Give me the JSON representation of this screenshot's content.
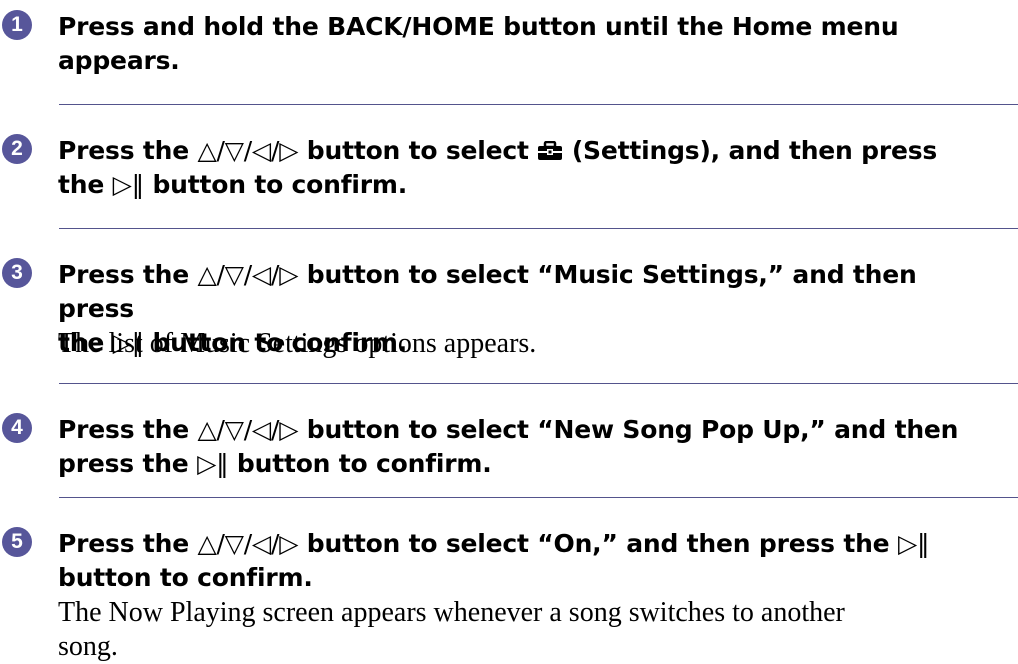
{
  "steps": [
    {
      "number": "1",
      "line1": "Press and hold the BACK/HOME button until the Home menu",
      "line2": "appears."
    },
    {
      "number": "2",
      "line1_a": "Press the ",
      "line1_b": " button to select ",
      "line1_c": " (Settings), and then press",
      "line2_a": "the ",
      "line2_b": " button to confirm."
    },
    {
      "number": "3",
      "line1_a": "Press the ",
      "line1_b": " button to select “Music Settings,” and then press",
      "line2_a": "the ",
      "line2_b": " button to confirm.",
      "note": "The list of Music Settings options appears."
    },
    {
      "number": "4",
      "line1_a": "Press the ",
      "line1_b": " button to select “New Song Pop Up,” and then",
      "line2_a": "press the ",
      "line2_b": " button to confirm."
    },
    {
      "number": "5",
      "line1_a": "Press the ",
      "line1_b": " button to select “On,” and then press the ",
      "line2": "button to confirm.",
      "note_line1": "The Now Playing screen appears whenever a song switches to another",
      "note_line2": "song."
    }
  ],
  "symbols": {
    "direction_buttons": "△/▽/◁/▷",
    "play_pause_button": "▷‖"
  },
  "icons": {
    "settings": "toolbox-icon"
  },
  "colors": {
    "accent": "#57569a",
    "divider": "#54538c"
  }
}
